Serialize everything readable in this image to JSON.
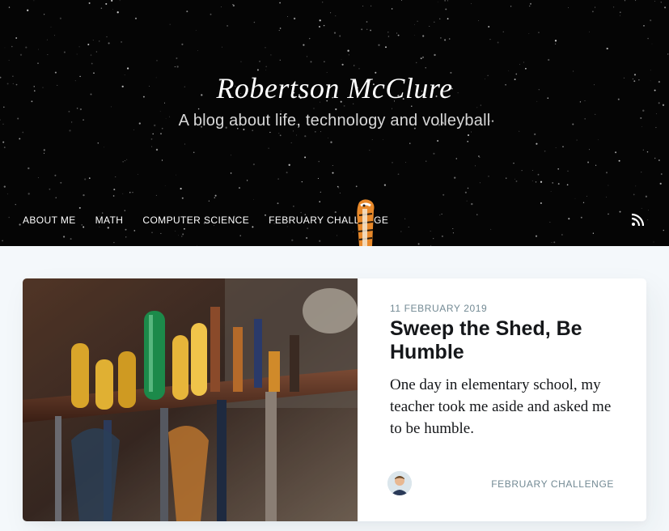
{
  "site": {
    "title": "Robertson McClure",
    "description": "A blog about life, technology and volleyball"
  },
  "nav": {
    "items": [
      {
        "label": "ABOUT ME"
      },
      {
        "label": "MATH"
      },
      {
        "label": "COMPUTER SCIENCE"
      },
      {
        "label": "FEBRUARY CHALLENGE"
      }
    ],
    "rss_icon": "rss-icon"
  },
  "post": {
    "date": "11 FEBRUARY 2019",
    "title": "Sweep the Shed, Be Humble",
    "excerpt": "One day in elementary school, my teacher took me aside and asked me to be humble.",
    "tag": "FEBRUARY CHALLENGE",
    "image": "tool-rack-photo",
    "author_avatar": "author-avatar"
  },
  "colors": {
    "header_bg": "#050505",
    "page_bg": "#f4f8fb",
    "meta_text": "#738a94",
    "title_text": "#15171a"
  }
}
